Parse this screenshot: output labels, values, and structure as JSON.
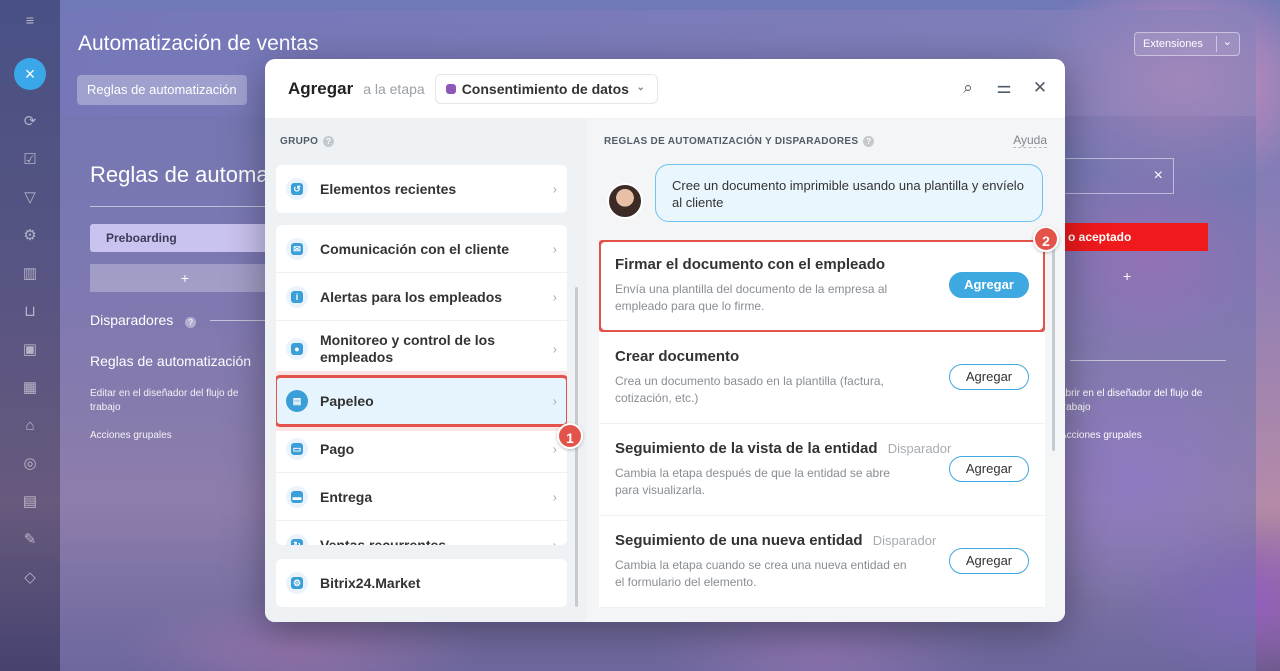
{
  "background_page": {
    "title": "Automatización de ventas",
    "extensions_button": "Extensiones",
    "tab": "Reglas de automatización",
    "heading": "Reglas de automa",
    "stage": "Preboarding",
    "add_stage": "+",
    "triggers_label": "Disparadores",
    "rules_label": "Reglas de automatización",
    "edit_link": "Editar en el diseñador del flujo de trabajo",
    "group_actions": "Acciones grupales",
    "right_stage": "o aceptado",
    "right_add": "+",
    "right_edit_link": "abrir en el diseñador del flujo de trabajo",
    "right_group_actions": "Acciones grupales",
    "close_icon": "×"
  },
  "modal": {
    "title": "Agregar",
    "stage_label": "a la etapa",
    "stage_value": "Consentimiento de datos",
    "stage_color": "#8e58b8",
    "icons": [
      "search-icon",
      "filter-icon",
      "close-icon"
    ],
    "group_section": {
      "title": "GRUPO",
      "recent": "Elementos recientes",
      "items": [
        {
          "label": "Comunicación con el cliente",
          "icon": "chat-icon"
        },
        {
          "label": "Alertas para los empleados",
          "icon": "info-icon"
        },
        {
          "label": "Monitoreo y control de los empleados",
          "icon": "users-icon"
        },
        {
          "label": "Papeleo",
          "icon": "document-icon"
        },
        {
          "label": "Pago",
          "icon": "wallet-icon"
        },
        {
          "label": "Entrega",
          "icon": "truck-icon"
        },
        {
          "label": "Ventas recurrentes",
          "icon": "repeat-icon"
        }
      ],
      "market": "Bitrix24.Market",
      "active_badge": "1"
    },
    "rules_section": {
      "title": "REGLAS DE AUTOMATIZACIÓN Y DISPARADORES",
      "help": "Ayuda",
      "bubble_text": "Cree un documento imprimible usando una plantilla y envíelo al cliente",
      "highlight_badge": "2",
      "rules": [
        {
          "title": "Firmar el documento con el empleado",
          "tag": "",
          "desc": "Envía una plantilla del documento de la empresa al empleado para que lo firme.",
          "button": "Agregar"
        },
        {
          "title": "Crear documento",
          "tag": "",
          "desc": "Crea un documento basado en la plantilla (factura, cotización, etc.)",
          "button": "Agregar"
        },
        {
          "title": "Seguimiento de la vista de la entidad",
          "tag": "Disparador",
          "desc": "Cambia la etapa después de que la entidad se abre para visualizarla.",
          "button": "Agregar"
        },
        {
          "title": "Seguimiento de una nueva entidad",
          "tag": "Disparador",
          "desc": "Cambia la etapa cuando se crea una nueva entidad en el formulario del elemento.",
          "button": "Agregar"
        }
      ]
    }
  }
}
